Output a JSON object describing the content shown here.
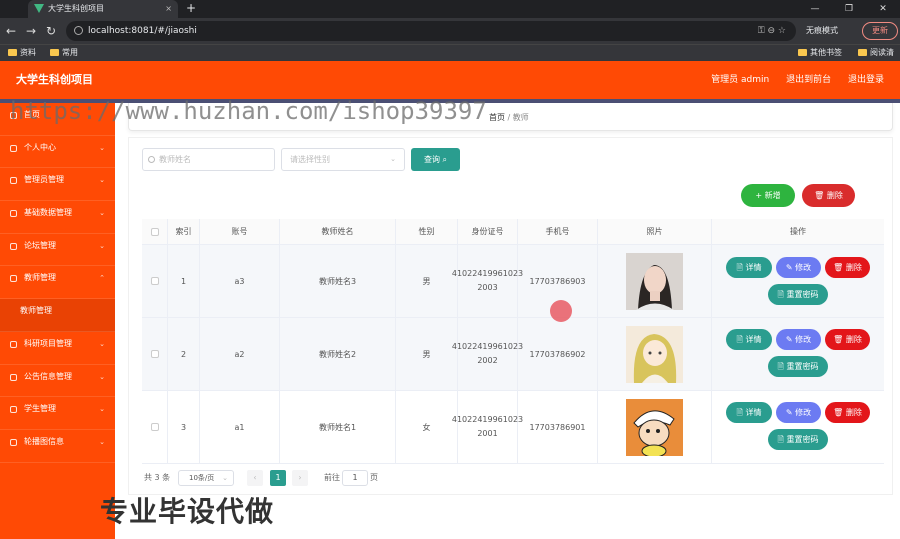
{
  "browser": {
    "tab_title": "大学生科创项目",
    "tab_close": "×",
    "new_tab": "+",
    "window_controls": [
      "—",
      "❐",
      "✕"
    ],
    "nav": {
      "back": "←",
      "forward": "→",
      "reload": "↻"
    },
    "url": "localhost:8081/#/jiaoshi",
    "url_icons": "⚿  ⊖  ☆",
    "incognito_label": "无痕模式",
    "update_label": "更新",
    "bookmarks": [
      "资料",
      "常用"
    ],
    "bookmarks_right": [
      "其他书签",
      "阅读清单"
    ]
  },
  "header": {
    "brand": "大学生科创项目",
    "user_label": "管理员 admin",
    "back_label": "退出到前台",
    "logout_label": "退出登录"
  },
  "watermark": "https://www.huzhan.com/ishop39397",
  "sidebar": {
    "items": [
      {
        "label": "首页"
      },
      {
        "label": "个人中心",
        "arrow": "⌄"
      },
      {
        "label": "管理员管理",
        "arrow": "⌄"
      },
      {
        "label": "基础数据管理",
        "arrow": "⌄"
      },
      {
        "label": "论坛管理",
        "arrow": "⌄"
      },
      {
        "label": "教师管理",
        "arrow": "⌃"
      },
      {
        "label": "教师管理",
        "sub": true
      },
      {
        "label": "科研项目管理",
        "arrow": "⌄"
      },
      {
        "label": "公告信息管理",
        "arrow": "⌄"
      },
      {
        "label": "学生管理",
        "arrow": "⌄"
      },
      {
        "label": "轮播图信息",
        "arrow": "⌄"
      }
    ]
  },
  "breadcrumb": {
    "home": "首页",
    "sep": "/",
    "current": "教师"
  },
  "search": {
    "name_placeholder": "教师姓名",
    "gender_placeholder": "请选择性别",
    "gender_chevron": "⌄",
    "query_label": "查询 ⌕"
  },
  "actions": {
    "add_label": "+ 新增",
    "delete_label": "🗑 删除"
  },
  "table": {
    "headers": [
      "",
      "索引",
      "账号",
      "教师姓名",
      "性别",
      "身份证号",
      "手机号",
      "照片",
      "操作"
    ],
    "rows": [
      {
        "index": "1",
        "account": "a3",
        "name": "教师姓名3",
        "gender": "男",
        "id_card": "41022419961023 2003",
        "phone": "17703786903"
      },
      {
        "index": "2",
        "account": "a2",
        "name": "教师姓名2",
        "gender": "男",
        "id_card": "41022419961023 2002",
        "phone": "17703786902"
      },
      {
        "index": "3",
        "account": "a1",
        "name": "教师姓名1",
        "gender": "女",
        "id_card": "41022419961023 2001",
        "phone": "17703786901"
      }
    ],
    "row_actions": {
      "detail": "🗎 详情",
      "edit": "✎ 修改",
      "delete": "🗑 删除",
      "reset": "🗎 重置密码"
    }
  },
  "pagination": {
    "total": "共 3 条",
    "page_size": "10条/页",
    "page_size_chevron": "⌄",
    "prev": "‹",
    "current_page": "1",
    "next": "›",
    "goto_label": "前往",
    "goto_value": "1",
    "page_suffix": "页"
  },
  "promo": "专业毕设代做",
  "colors": {
    "brand": "#ff4a05",
    "teal": "#2a9d8f",
    "green": "#2eb43f",
    "red": "#d92c2c",
    "purple": "#6c7bf2"
  }
}
